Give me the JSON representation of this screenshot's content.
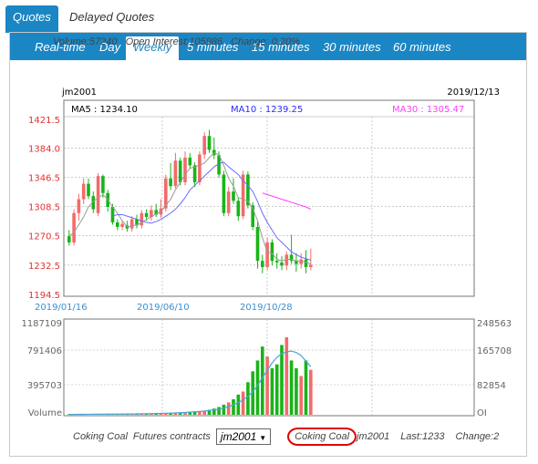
{
  "top_tabs": [
    {
      "label": "Quotes",
      "active": true
    },
    {
      "label": "Delayed Quotes",
      "active": false
    }
  ],
  "period_tabs": [
    {
      "label": "Real-time",
      "active": false
    },
    {
      "label": "Day",
      "active": false
    },
    {
      "label": "Weekly",
      "active": true
    },
    {
      "label": "5 minutes",
      "active": false
    },
    {
      "label": "15 minutes",
      "active": false
    },
    {
      "label": "30 minutes",
      "active": false
    },
    {
      "label": "60 minutes",
      "active": false
    }
  ],
  "info": {
    "volume": "Volume:57240",
    "open_interest": "Open Interest:105986",
    "change": "Change: 0.20%"
  },
  "contract_code": "jm2001",
  "date": "2019/12/13",
  "ma": {
    "ma5": "MA5 : 1234.10",
    "ma10": "MA10 : 1239.25",
    "ma30": "MA30 : 1305.47",
    "ma5_color": "#000000",
    "ma10_color": "#2a2aff",
    "ma30_color": "#ff3cff"
  },
  "colors": {
    "up": "#f26b6b",
    "down": "#18b418",
    "accent": "#1a86c4",
    "price_axis": "#e23030",
    "date_axis": "#3a8fd0",
    "oi_line": "#4aa3e0"
  },
  "bottom": {
    "product": "Coking Coal",
    "futures_label": "Futures contracts",
    "selected_contract": "jm2001",
    "circled_product": "Coking Coal",
    "contract": "jm2001",
    "last": "Last:1233",
    "change": "Change:2"
  },
  "chart_data": [
    {
      "type": "candlestick",
      "title": "",
      "y_ticks": [
        "1421.5",
        "1384.0",
        "1346.5",
        "1308.5",
        "1270.5",
        "1232.5",
        "1194.5"
      ],
      "ylim": [
        1194.5,
        1421.5
      ],
      "x_ticks": [
        "2019/01/16",
        "2019/06/10",
        "2019/10/28"
      ],
      "candles": [
        [
          1270,
          1262,
          1278,
          1258
        ],
        [
          1262,
          1300,
          1305,
          1258
        ],
        [
          1300,
          1318,
          1325,
          1290
        ],
        [
          1318,
          1338,
          1345,
          1312
        ],
        [
          1338,
          1322,
          1345,
          1318
        ],
        [
          1322,
          1305,
          1328,
          1300
        ],
        [
          1300,
          1348,
          1352,
          1296
        ],
        [
          1348,
          1326,
          1350,
          1320
        ],
        [
          1326,
          1308,
          1330,
          1302
        ],
        [
          1308,
          1288,
          1312,
          1285
        ],
        [
          1288,
          1282,
          1292,
          1278
        ],
        [
          1282,
          1286,
          1290,
          1278
        ],
        [
          1284,
          1280,
          1290,
          1276
        ],
        [
          1280,
          1292,
          1296,
          1276
        ],
        [
          1292,
          1284,
          1298,
          1280
        ],
        [
          1284,
          1300,
          1304,
          1280
        ],
        [
          1300,
          1295,
          1305,
          1290
        ],
        [
          1295,
          1304,
          1310,
          1290
        ],
        [
          1304,
          1298,
          1312,
          1295
        ],
        [
          1298,
          1306,
          1318,
          1294
        ],
        [
          1306,
          1345,
          1350,
          1302
        ],
        [
          1345,
          1335,
          1365,
          1330
        ],
        [
          1335,
          1368,
          1378,
          1332
        ],
        [
          1368,
          1340,
          1372,
          1336
        ],
        [
          1340,
          1372,
          1380,
          1336
        ],
        [
          1372,
          1362,
          1378,
          1358
        ],
        [
          1362,
          1340,
          1366,
          1334
        ],
        [
          1340,
          1376,
          1380,
          1336
        ],
        [
          1376,
          1400,
          1405,
          1370
        ],
        [
          1400,
          1382,
          1408,
          1378
        ],
        [
          1382,
          1375,
          1398,
          1370
        ],
        [
          1375,
          1350,
          1380,
          1346
        ],
        [
          1350,
          1300,
          1355,
          1296
        ],
        [
          1300,
          1328,
          1334,
          1296
        ],
        [
          1328,
          1316,
          1345,
          1312
        ],
        [
          1316,
          1296,
          1320,
          1290
        ],
        [
          1296,
          1350,
          1355,
          1292
        ],
        [
          1350,
          1310,
          1354,
          1306
        ],
        [
          1310,
          1282,
          1314,
          1278
        ],
        [
          1282,
          1238,
          1290,
          1228
        ],
        [
          1238,
          1230,
          1246,
          1222
        ],
        [
          1230,
          1262,
          1268,
          1226
        ],
        [
          1262,
          1238,
          1266,
          1232
        ],
        [
          1238,
          1236,
          1248,
          1228
        ],
        [
          1236,
          1232,
          1244,
          1226
        ],
        [
          1232,
          1246,
          1250,
          1226
        ],
        [
          1246,
          1238,
          1272,
          1234
        ],
        [
          1238,
          1234,
          1248,
          1224
        ],
        [
          1234,
          1240,
          1248,
          1228
        ],
        [
          1240,
          1230,
          1252,
          1222
        ],
        [
          1230,
          1233,
          1254,
          1226
        ]
      ],
      "ma5": [
        1270,
        1275,
        1285,
        1295,
        1308,
        1315,
        1320,
        1324,
        1318,
        1308,
        1300,
        1290,
        1282,
        1283,
        1285,
        1287,
        1292,
        1295,
        1299,
        1302,
        1310,
        1318,
        1330,
        1340,
        1350,
        1358,
        1360,
        1362,
        1365,
        1372,
        1378,
        1376,
        1362,
        1345,
        1335,
        1320,
        1318,
        1316,
        1306,
        1290,
        1268,
        1250,
        1248,
        1240,
        1238,
        1240,
        1240,
        1238,
        1238,
        1236,
        1234
      ],
      "ma10": [
        null,
        null,
        null,
        null,
        null,
        null,
        null,
        null,
        null,
        1296,
        1298,
        1298,
        1296,
        1294,
        1292,
        1290,
        1288,
        1287,
        1289,
        1292,
        1296,
        1300,
        1305,
        1312,
        1320,
        1330,
        1336,
        1342,
        1348,
        1354,
        1360,
        1364,
        1366,
        1360,
        1355,
        1350,
        1342,
        1336,
        1328,
        1315,
        1300,
        1288,
        1278,
        1268,
        1262,
        1256,
        1250,
        1246,
        1243,
        1241,
        1239
      ],
      "ma30": [
        null,
        null,
        null,
        null,
        null,
        null,
        null,
        null,
        null,
        null,
        null,
        null,
        null,
        null,
        null,
        null,
        null,
        null,
        null,
        null,
        null,
        null,
        null,
        null,
        null,
        null,
        null,
        null,
        null,
        null,
        null,
        null,
        null,
        null,
        null,
        null,
        null,
        null,
        null,
        null,
        1326,
        1324,
        1322,
        1320,
        1318,
        1316,
        1314,
        1312,
        1310,
        1308,
        1305
      ]
    },
    {
      "type": "bar",
      "title": "",
      "series_name": "Volume",
      "y_ticks_left": [
        "1187109",
        "791406",
        "395703",
        "Volume"
      ],
      "y_ticks_right": [
        "248563",
        "165708",
        "82854",
        "OI"
      ],
      "ylim_volume": [
        0,
        1187109
      ],
      "ylim_oi": [
        0,
        248563
      ],
      "volume": [
        8000,
        9000,
        10000,
        11000,
        12000,
        10000,
        13000,
        12000,
        11000,
        10000,
        9000,
        10000,
        11000,
        12000,
        13000,
        14000,
        15000,
        16000,
        18000,
        20000,
        22000,
        25000,
        28000,
        30000,
        34000,
        38000,
        42000,
        48000,
        55000,
        65000,
        80000,
        100000,
        130000,
        160000,
        200000,
        260000,
        300000,
        420000,
        560000,
        700000,
        880000,
        750000,
        600000,
        650000,
        900000,
        1000000,
        700000,
        600000,
        500000,
        700000,
        580000
      ],
      "up_down": [
        0,
        1,
        1,
        1,
        0,
        0,
        1,
        0,
        0,
        0,
        0,
        1,
        0,
        1,
        0,
        1,
        0,
        1,
        0,
        1,
        1,
        0,
        1,
        0,
        1,
        0,
        0,
        1,
        1,
        0,
        0,
        0,
        0,
        1,
        0,
        0,
        1,
        0,
        0,
        0,
        0,
        1,
        0,
        0,
        0,
        1,
        0,
        0,
        1,
        0,
        1
      ],
      "oi": [
        1000,
        1100,
        1200,
        1300,
        1400,
        1500,
        1600,
        1700,
        1800,
        1900,
        2000,
        2100,
        2200,
        2300,
        2500,
        2700,
        2900,
        3100,
        3400,
        3700,
        4000,
        4500,
        5000,
        5600,
        6200,
        7000,
        8000,
        9000,
        10000,
        11500,
        13000,
        15000,
        18000,
        22000,
        27000,
        33000,
        40000,
        50000,
        62000,
        80000,
        100000,
        120000,
        140000,
        155000,
        165000,
        170000,
        172000,
        168000,
        160000,
        145000,
        130000
      ]
    }
  ]
}
